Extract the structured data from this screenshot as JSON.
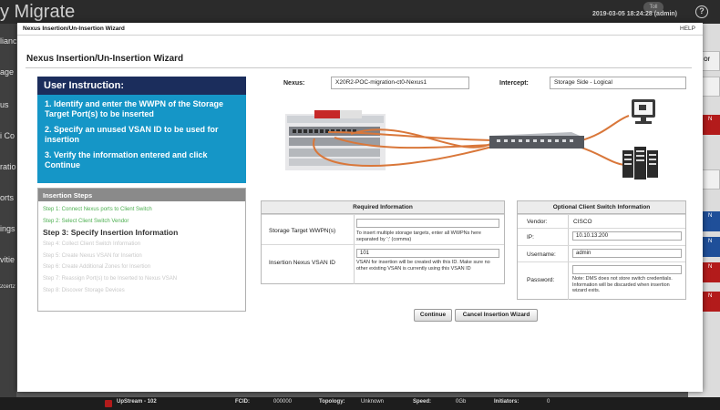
{
  "background": {
    "app_title": "y Migrate",
    "datetime": "2019-03-05 18:24:28 (admin)",
    "user_badge": "Toll",
    "help_glyph": "?",
    "sidebar_fragments": [
      "liance",
      "age",
      "us",
      "i Co",
      "ratio",
      "orts",
      "ings",
      "vitie",
      "2cert2"
    ],
    "right_fragments": [
      "Of",
      "N",
      "N",
      "N",
      "N",
      "N"
    ],
    "bottom_bar": {
      "name": "UpStream - 102",
      "fcid_label": "FCID:",
      "fcid_value": "000000",
      "topology_label": "Topology:",
      "topology_value": "Unknown",
      "speed_label": "Speed:",
      "speed_value": "0Gb",
      "initiators_label": "Initiators:",
      "initiators_value": "0"
    }
  },
  "dialog": {
    "titlebar_title": "Nexus Insertion/Un-Insertion Wizard",
    "help_label": "HELP",
    "wizard_title": "Nexus Insertion/Un-Insertion Wizard"
  },
  "instruction": {
    "heading": "User Instruction:",
    "items": [
      "1. Identify and enter the WWPN of the Storage Target Port(s) to be inserted",
      "2. Specify an unused VSAN ID to be used for insertion",
      "3. Verify the information entered and click Continue"
    ]
  },
  "steps": {
    "heading": "Insertion Steps",
    "items": [
      "Step 1: Connect Nexus ports to Client Switch",
      "Step 2: Select Client Switch Vendor",
      "Step 3: Specify Insertion Information",
      "Step 4: Collect Client Switch Information",
      "Step 5: Create Nexus VSAN for Insertion",
      "Step 6: Create Additional Zones for Insertion",
      "Step 7: Reassign Port(s) to be Inserted to Nexus VSAN",
      "Step 8: Discover Storage Devices"
    ]
  },
  "top_fields": {
    "nexus_label": "Nexus:",
    "nexus_value": "X20R2-POC-migration-ct0-Nexus1",
    "intercept_label": "Intercept:",
    "intercept_value": "Storage Side - Logical"
  },
  "required": {
    "heading": "Required Information",
    "wwpn_label": "Storage Target WWPN(s)",
    "wwpn_value": "",
    "wwpn_help": "To insert multiple storage targets, enter all WWPNs here separated by ';' (comma)",
    "vsan_label": "Insertion Nexus VSAN ID",
    "vsan_value": "101",
    "vsan_help": "VSAN for insertion will be created with this ID. Make sure no other existing VSAN is currently using this VSAN ID"
  },
  "optional": {
    "heading": "Optional Client Switch Information",
    "vendor_label": "Vendor:",
    "vendor_value": "CISCO",
    "ip_label": "IP:",
    "ip_value": "10.10.13.200",
    "username_label": "Username:",
    "username_value": "admin",
    "password_label": "Password:",
    "password_value": "",
    "password_help": "Note: DMS does not store switch credentials. Information will be discarded when insertion wizard exits."
  },
  "buttons": {
    "continue": "Continue",
    "cancel": "Cancel Insertion Wizard"
  },
  "colors": {
    "instruction_bg": "#1596c7",
    "instruction_head": "#1b2d5c",
    "step_done": "#4caf50",
    "cable": "#d9773a"
  }
}
